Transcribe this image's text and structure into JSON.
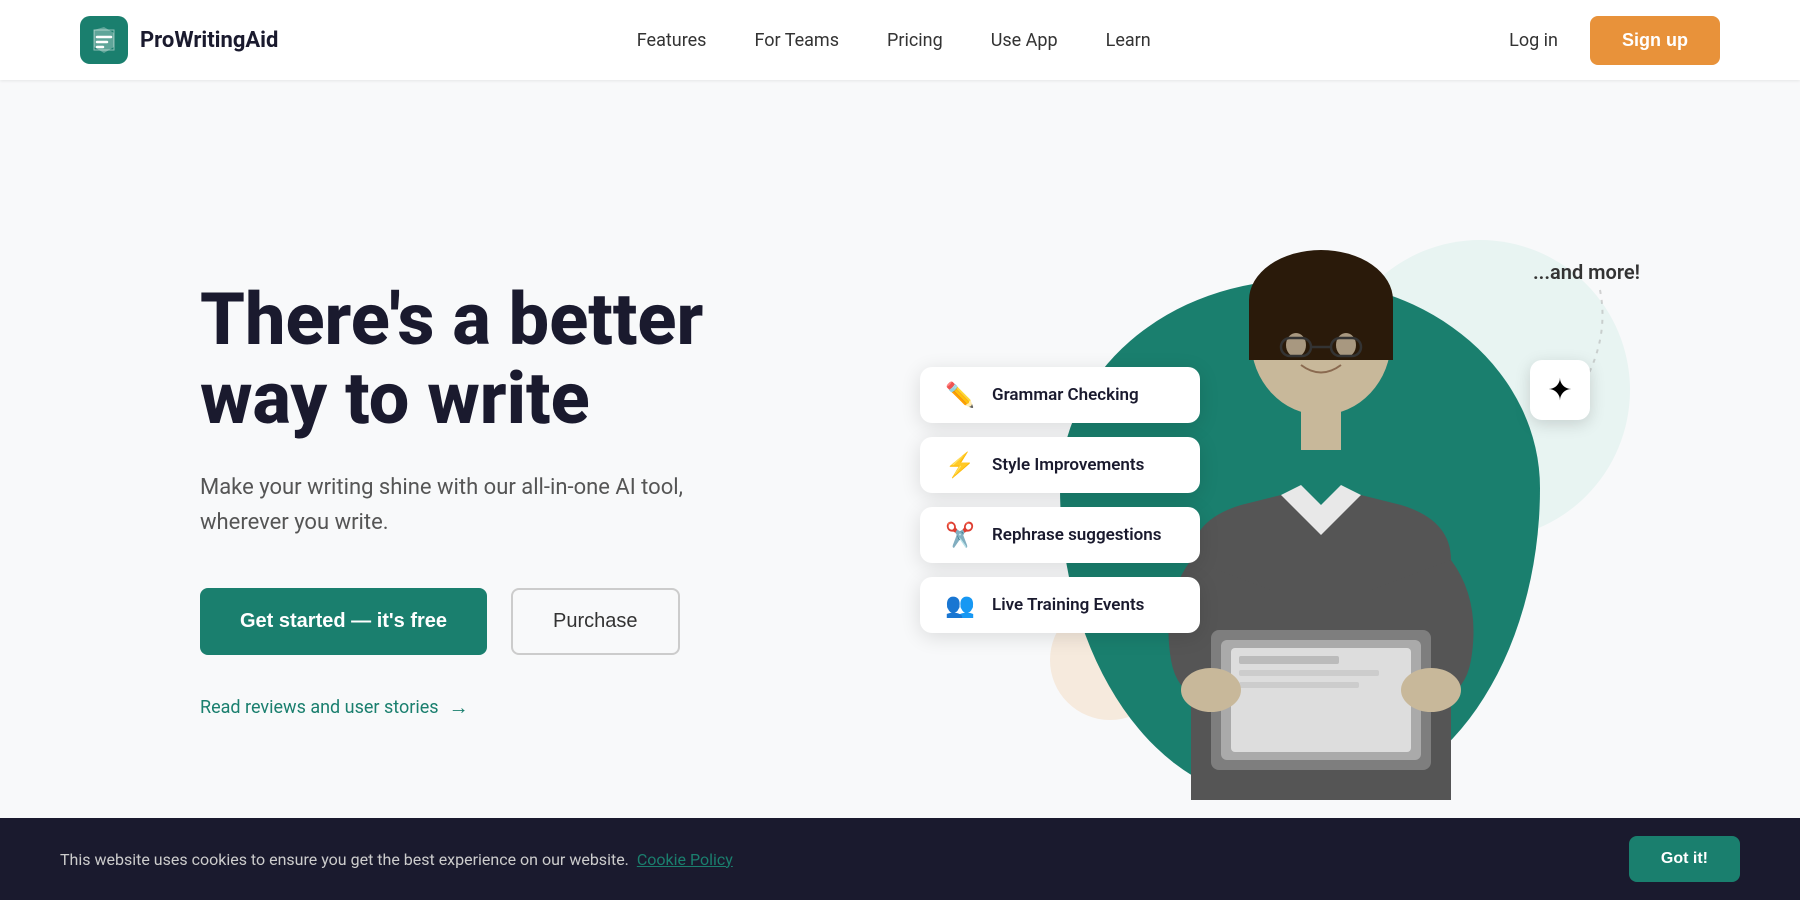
{
  "header": {
    "logo_text": "ProWritingAid",
    "nav": {
      "features": "Features",
      "for_teams": "For Teams",
      "pricing": "Pricing",
      "use_app": "Use App",
      "learn": "Learn"
    },
    "login": "Log in",
    "signup": "Sign up"
  },
  "hero": {
    "title_line1": "There's a better",
    "title_line2": "way to write",
    "subtitle": "Make your writing shine with our all-in-one AI tool, wherever you write.",
    "cta_primary": "Get started  —  it's free",
    "cta_secondary": "Purchase",
    "reviews_link": "Read reviews and user stories"
  },
  "features": [
    {
      "icon": "✏️",
      "label": "Grammar Checking"
    },
    {
      "icon": "⚡",
      "label": "Style Improvements"
    },
    {
      "icon": "✂️",
      "label": "Rephrase suggestions"
    },
    {
      "icon": "👥",
      "label": "Live Training Events"
    }
  ],
  "and_more": "...and more!",
  "cookie": {
    "text": "This website uses cookies to ensure you get the best experience on our website.",
    "link_text": "Cookie Policy",
    "button": "Got it!"
  }
}
